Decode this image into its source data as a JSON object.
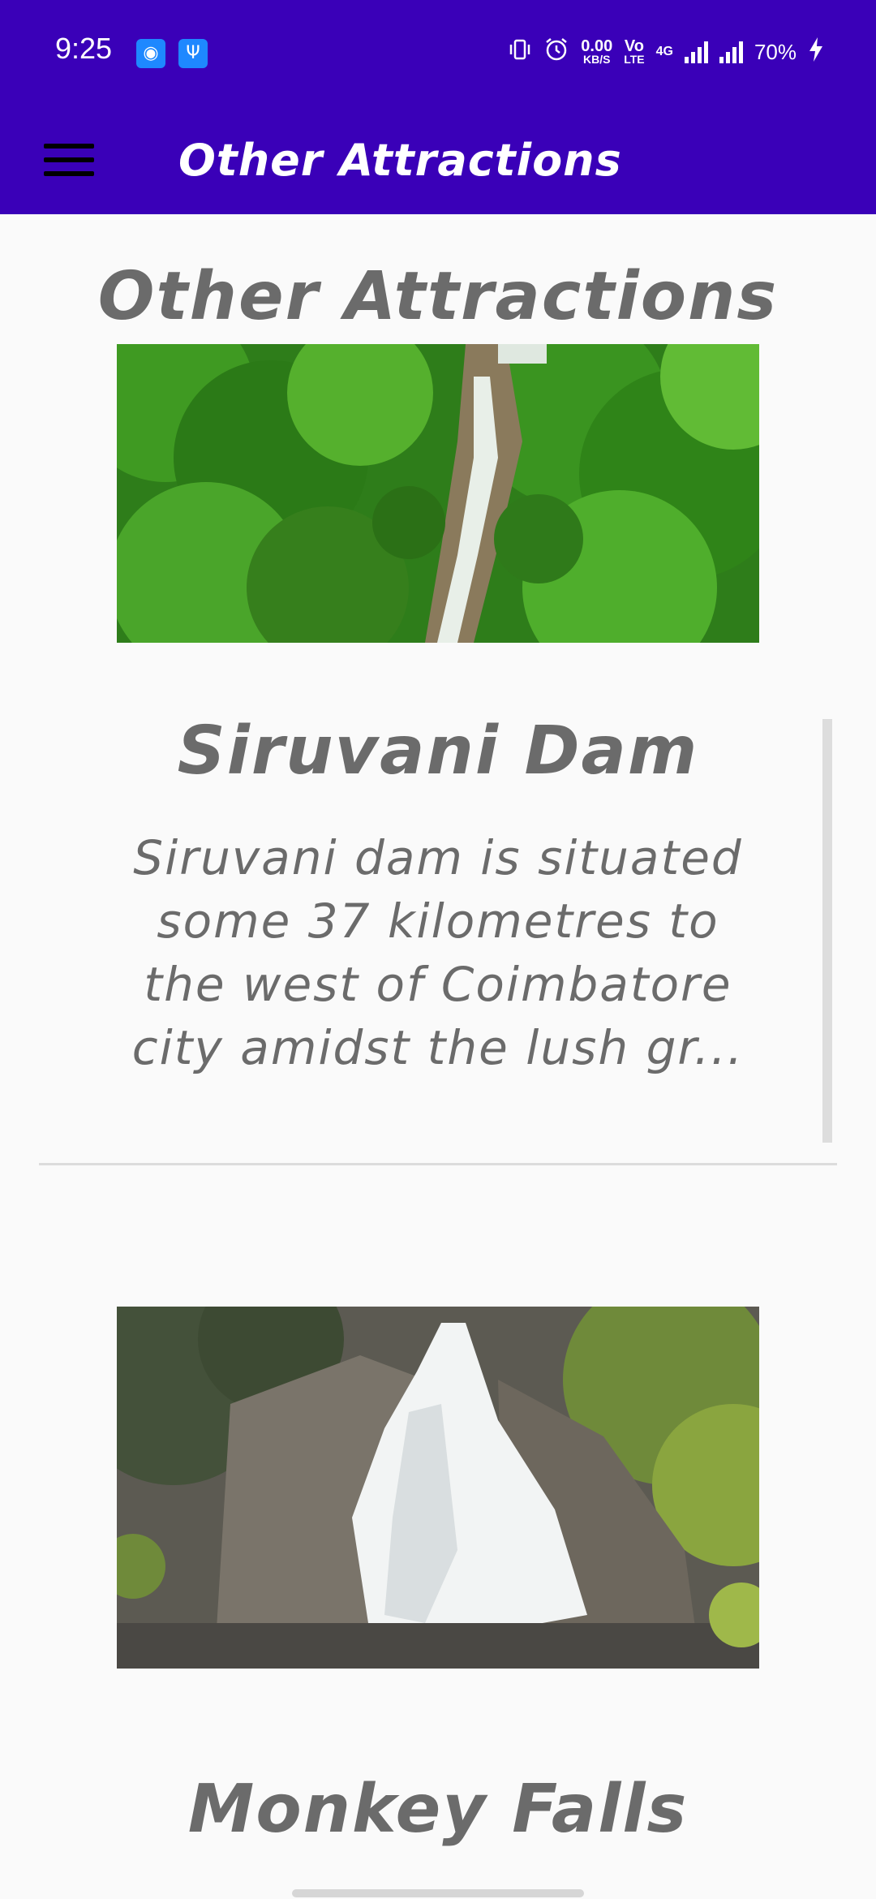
{
  "status_bar": {
    "time": "9:25",
    "net_speed": "0.00",
    "net_speed_unit": "KB/S",
    "volte_top": "Vo",
    "volte_bottom": "LTE",
    "network_type": "4G",
    "battery": "70%",
    "icons": [
      "android-icon",
      "usb-icon",
      "vibrate-icon",
      "alarm-icon",
      "signal-icon",
      "charging-icon"
    ]
  },
  "app_bar": {
    "title": "Other Attractions",
    "menu_icon": "hamburger-menu-icon"
  },
  "page": {
    "heading": "Other Attractions"
  },
  "attractions": [
    {
      "title": "Siruvani Dam",
      "description": "Siruvani dam is situated some 37 kilometres to the west of Coimbatore city amidst the lush gr..."
    },
    {
      "title": "Monkey Falls",
      "description": ""
    }
  ],
  "colors": {
    "primary": "#3a00b8",
    "background": "#fafafa",
    "text": "#6b6b6b"
  }
}
